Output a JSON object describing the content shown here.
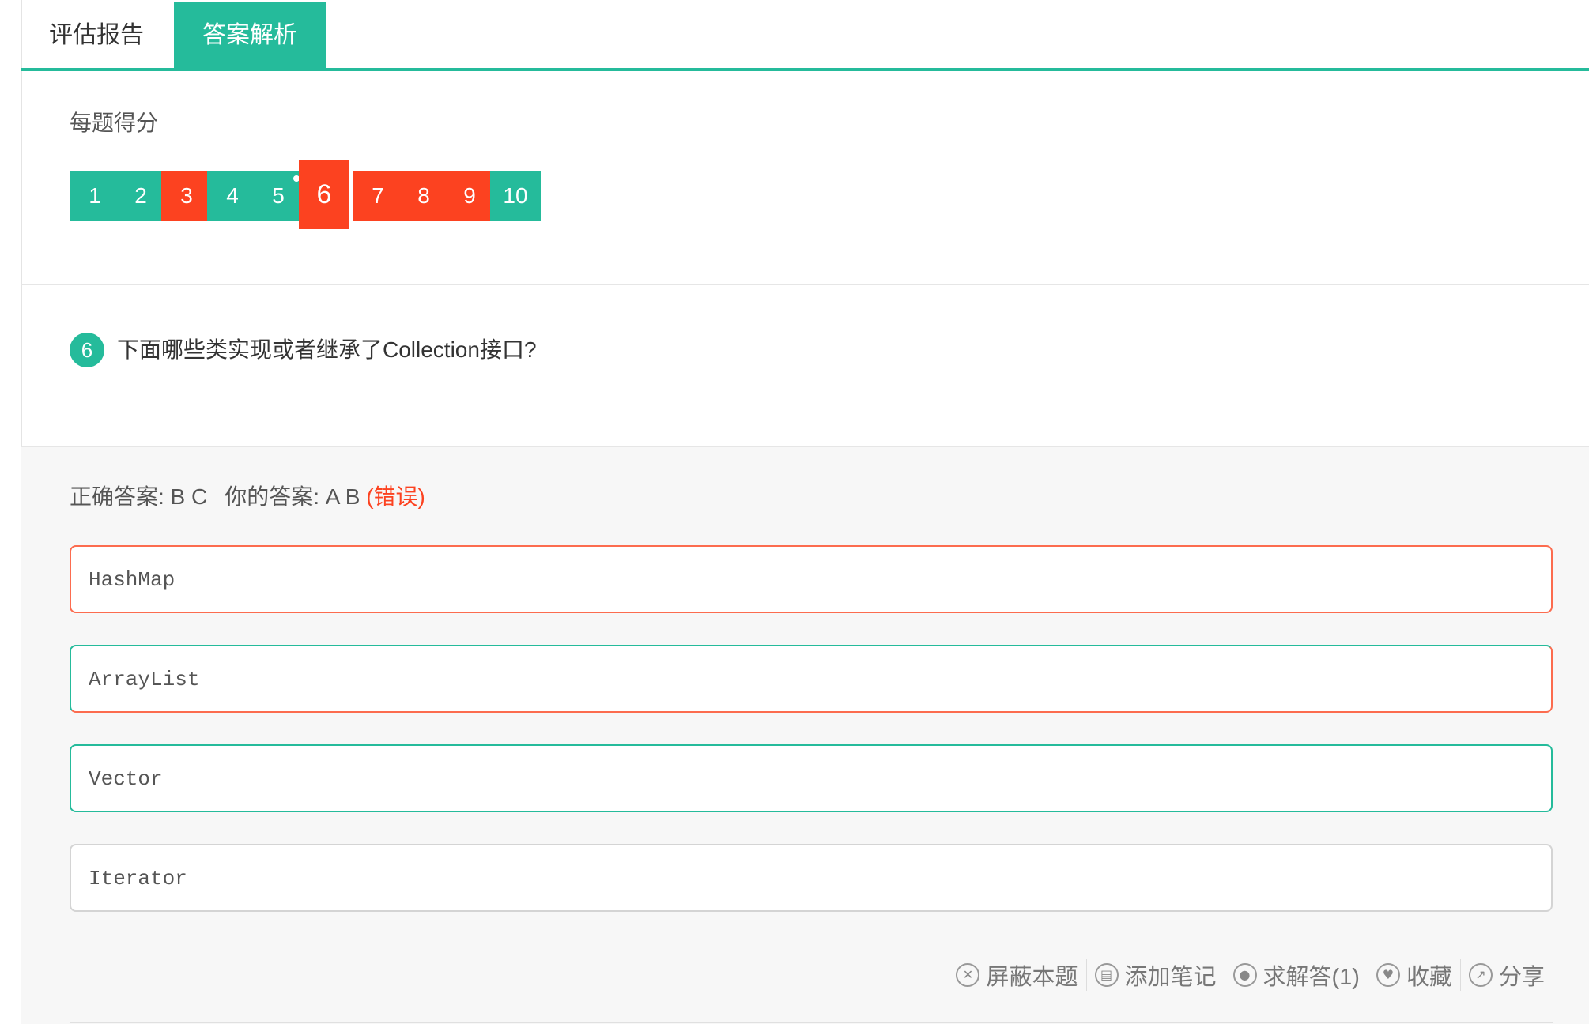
{
  "tabs": [
    {
      "label": "评估报告",
      "active": false
    },
    {
      "label": "答案解析",
      "active": true
    }
  ],
  "score": {
    "title": "每题得分",
    "questions": [
      {
        "num": "1",
        "status": "correct"
      },
      {
        "num": "2",
        "status": "correct"
      },
      {
        "num": "3",
        "status": "wrong"
      },
      {
        "num": "4",
        "status": "correct"
      },
      {
        "num": "5",
        "status": "correct",
        "marked": true
      },
      {
        "num": "6",
        "status": "wrong",
        "current": true
      },
      {
        "num": "7",
        "status": "wrong"
      },
      {
        "num": "8",
        "status": "wrong"
      },
      {
        "num": "9",
        "status": "wrong"
      },
      {
        "num": "10",
        "status": "correct"
      }
    ]
  },
  "question": {
    "number": "6",
    "text": "下面哪些类实现或者继承了Collection接口?"
  },
  "answer": {
    "correct_label": "正确答案: B C",
    "your_label": "你的答案: A B",
    "result": "(错误)"
  },
  "options": [
    {
      "text": "HashMap"
    },
    {
      "text": "ArrayList"
    },
    {
      "text": "Vector"
    },
    {
      "text": "Iterator"
    }
  ],
  "actions": {
    "hide": "屏蔽本题",
    "note": "添加笔记",
    "ask": "求解答(1)",
    "favorite": "收藏",
    "share": "分享"
  },
  "colors": {
    "accent": "#25bb9b",
    "error": "#fc4220"
  }
}
